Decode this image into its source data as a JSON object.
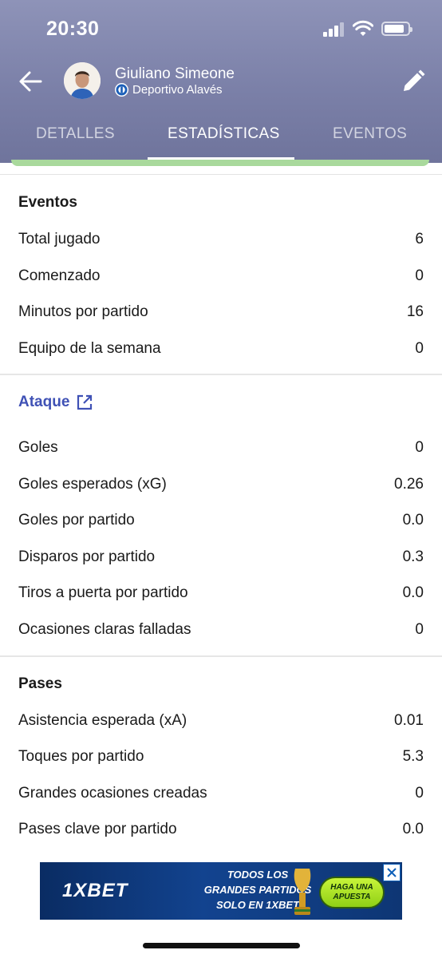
{
  "status_bar": {
    "time": "20:30"
  },
  "header": {
    "player_name": "Giuliano Simeone",
    "team_name": "Deportivo Alavés",
    "background_color": "#7b80a8",
    "icons": {
      "back": "arrow-left-icon",
      "edit": "pencil-icon",
      "team": "team-crest-icon"
    }
  },
  "tabs": [
    {
      "label": "DETALLES",
      "active": false
    },
    {
      "label": "ESTADÍSTICAS",
      "active": true
    },
    {
      "label": "EVENTOS",
      "active": false
    }
  ],
  "sections": {
    "eventos": {
      "title": "Eventos",
      "rows": [
        {
          "label": "Total jugado",
          "value": "6"
        },
        {
          "label": "Comenzado",
          "value": "0"
        },
        {
          "label": "Minutos por partido",
          "value": "16"
        },
        {
          "label": "Equipo de la semana",
          "value": "0"
        }
      ]
    },
    "ataque": {
      "title": "Ataque",
      "link_icon": "open-in-new-icon",
      "accent_color": "#3f51b5",
      "rows": [
        {
          "label": "Goles",
          "value": "0"
        },
        {
          "label": "Goles esperados (xG)",
          "value": "0.26"
        },
        {
          "label": "Goles por partido",
          "value": "0.0"
        },
        {
          "label": "Disparos por partido",
          "value": "0.3"
        },
        {
          "label": "Tiros a puerta por partido",
          "value": "0.0"
        },
        {
          "label": "Ocasiones claras falladas",
          "value": "0"
        }
      ]
    },
    "pases": {
      "title": "Pases",
      "rows": [
        {
          "label": "Asistencia esperada (xA)",
          "value": "0.01"
        },
        {
          "label": "Toques por partido",
          "value": "5.3"
        },
        {
          "label": "Grandes ocasiones creadas",
          "value": "0"
        },
        {
          "label": "Pases clave por partido",
          "value": "0.0"
        }
      ]
    }
  },
  "ad": {
    "brand": "1XBET",
    "headline_1": "TODOS LOS",
    "headline_2": "GRANDES PARTIDOS",
    "headline_3": "SOLO EN 1XBET",
    "cta_1": "HAGA UNA",
    "cta_2": "APUESTA",
    "close_icon": "close-icon"
  }
}
